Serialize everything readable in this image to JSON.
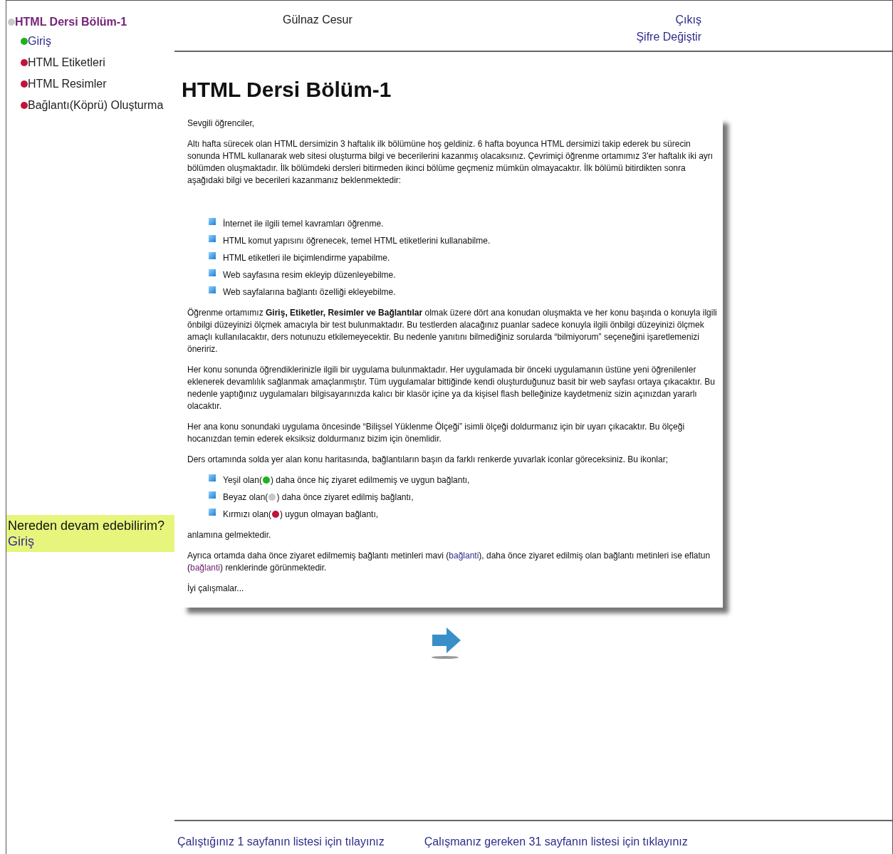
{
  "sidebar": {
    "items": [
      {
        "label": "HTML Dersi Bölüm-1",
        "color": "#c8c8c8",
        "visited": true,
        "children": [
          {
            "label": "Giriş",
            "color": "#22b022",
            "visited": false,
            "disabled": false
          },
          {
            "label": "HTML Etiketleri",
            "color": "#c0143a",
            "visited": false,
            "disabled": true
          },
          {
            "label": "HTML Resimler",
            "color": "#c0143a",
            "visited": false,
            "disabled": true
          },
          {
            "label": "Bağlantı(Köprü) Oluşturma",
            "color": "#c0143a",
            "visited": false,
            "disabled": true
          }
        ]
      }
    ],
    "continue_box": {
      "title": "Nereden devam edebilirim?",
      "link": "Giriş"
    }
  },
  "header": {
    "user": "Gülnaz Cesur",
    "links": [
      "Çıkış",
      "Şifre Değiştir"
    ]
  },
  "page_title": "HTML Dersi Bölüm-1",
  "content": {
    "blocks": [
      {
        "kind": "paragraph",
        "text": "Sevgili öğrenciler,"
      },
      {
        "kind": "paragraph",
        "text": "Altı hafta sürecek olan HTML dersimizin 3 haftalık ilk bölümüne hoş geldiniz. 6 hafta boyunca HTML dersimizi takip ederek bu sürecin sonunda HTML kullanarak web sitesi oluşturma bilgi ve becerilerini kazanmış olacaksınız. Çevrimiçi öğrenme ortamımız 3'er haftalık iki ayrı bölümden oluşmaktadır. İlk bölümdeki dersleri bitirmeden ikinci bölüme geçmeniz mümkün olmayacaktır. İlk bölümü bitirdikten sonra aşağıdaki bilgi ve becerileri kazanmanız beklenmektedir:"
      },
      {
        "kind": "list",
        "items": [
          "İnternet ile ilgili temel kavramları öğrenme.",
          "HTML komut yapısını öğrenecek, temel HTML etiketlerini kullanabilme.",
          "HTML etiketleri ile biçimlendirme yapabilme.",
          "Web sayfasına resim ekleyip düzenleyebilme.",
          "Web sayfalarına bağlantı özelliği ekleyebilme."
        ]
      },
      {
        "kind": "paragraph",
        "text": "Öğrenme ortamımız **Giriş, Etiketler, Resimler ve Bağlantılar** olmak üzere dört ana konudan oluşmakta ve her konu başında o konuyla ilgili önbilgi düzeyinizi ölçmek amacıyla bir test bulunmaktadır. Bu testlerden alacağınız puanlar sadece konuyla ilgili önbilgi düzeyinizi ölçmek amaçlı kullanılacaktır, ders notunuzu etkilemeyecektir. Bu nedenle yanıtını bilmediğiniz sorularda “bilmiyorum” seçeneğini işaretlemenizi öneririz."
      },
      {
        "kind": "paragraph",
        "text": "Her konu sonunda öğrendiklerinizle ilgili bir uygulama bulunmaktadır. Her uygulamada bir önceki uygulamanın üstüne yeni öğrenilenler eklenerek devamlılık sağlanmak amaçlanmıştır. Tüm uygulamalar bittiğinde kendi oluşturduğunuz basit bir web sayfası ortaya çıkacaktır. Bu nedenle yaptığınız uygulamaları bilgisayarınızda kalıcı bir klasör içine ya da kişisel flash belleğinize kaydetmeniz sizin açınızdan yararlı olacaktır."
      },
      {
        "kind": "paragraph",
        "text": "Her ana konu sonundaki uygulama öncesinde “Bilişsel Yüklenme Ölçeği” isimli ölçeği doldurmanız için bir uyarı çıkacaktır. Bu ölçeği hocanızdan temin ederek eksiksiz doldurmanız bizim için önemlidir."
      },
      {
        "kind": "paragraph",
        "text": "Ders ortamında solda yer alan konu haritasında, bağlantıların başın da farklı renkerde yuvarlak iconlar göreceksiniz. Bu ikonlar;"
      },
      {
        "kind": "icon_list",
        "items": [
          {
            "before": "Yeşil olan(",
            "color": "#22b022",
            "after": ") daha önce hiç ziyaret edilmemiş ve uygun bağlantı,"
          },
          {
            "before": "Beyaz olan(",
            "color": "#c8c8c8",
            "after": ") daha önce ziyaret edilmiş bağlantı,"
          },
          {
            "before": "Kırmızı olan(",
            "color": "#c0143a",
            "after": ") uygun olmayan bağlantı,"
          }
        ]
      },
      {
        "kind": "paragraph",
        "text": "anlamına gelmektedir."
      },
      {
        "kind": "parts",
        "parts": [
          {
            "kind": "text",
            "text": "Ayrıca ortamda daha önce ziyaret edilmemiş bağlantı metinleri mavi ("
          },
          {
            "kind": "link",
            "text": "bağlanti",
            "visited": false
          },
          {
            "kind": "text",
            "text": "), daha önce ziyaret edilmiş olan bağlantı metinleri ise eflatun ("
          },
          {
            "kind": "link",
            "text": "bağlanti",
            "visited": true
          },
          {
            "kind": "text",
            "text": ") renklerinde görünmektedir."
          }
        ]
      },
      {
        "kind": "paragraph",
        "text": "İyi çalışmalar..."
      }
    ]
  },
  "footer": {
    "links": [
      "Çalıştığınız 1 sayfanın listesi için tılayınız",
      "Çalışmanız gereken 31 sayfanın listesi için tıklayınız"
    ]
  }
}
